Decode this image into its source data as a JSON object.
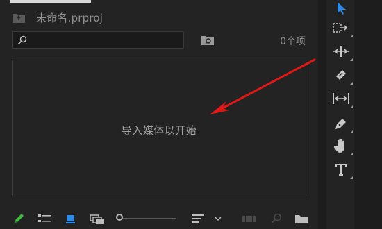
{
  "project": {
    "name": "未命名.prproj",
    "item_count": "0个项",
    "search": {
      "value": "",
      "placeholder": ""
    }
  },
  "drop_area": {
    "message": "导入媒体以开始"
  },
  "tools": [
    {
      "name": "selection-tool",
      "icon": "arrow-cursor-icon",
      "selected": true
    },
    {
      "name": "track-select-forward-tool",
      "icon": "track-select-icon"
    },
    {
      "name": "ripple-edit-tool",
      "icon": "ripple-edit-icon"
    },
    {
      "name": "razor-tool",
      "icon": "razor-icon"
    },
    {
      "name": "slip-tool",
      "icon": "slip-icon"
    },
    {
      "name": "pen-tool",
      "icon": "pen-icon"
    },
    {
      "name": "hand-tool",
      "icon": "hand-icon"
    },
    {
      "name": "type-tool",
      "icon": "type-icon"
    }
  ],
  "colors": {
    "accent": "#2e8be6",
    "annotation_arrow": "#e01818",
    "pencil": "#3dbb3d"
  }
}
